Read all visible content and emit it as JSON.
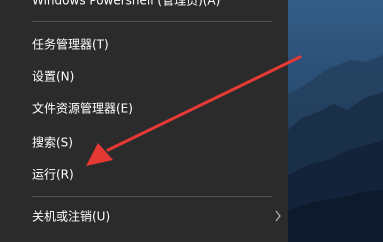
{
  "menu": {
    "items": [
      {
        "label": "Windows Powershell (管理员)(A)"
      },
      {
        "label": "任务管理器(T)"
      },
      {
        "label": "设置(N)"
      },
      {
        "label": "文件资源管理器(E)"
      },
      {
        "label": "搜索(S)"
      },
      {
        "label": "运行(R)"
      },
      {
        "label": "关机或注销(U)"
      }
    ]
  },
  "colors": {
    "menu_bg": "#2b2b2b",
    "text": "#ffffff",
    "separator": "#555555",
    "arrow": "#e53935",
    "wallpaper": "#2a4e74"
  },
  "icons": {
    "submenu": "chevron-right-icon",
    "annotation": "red-arrow"
  }
}
